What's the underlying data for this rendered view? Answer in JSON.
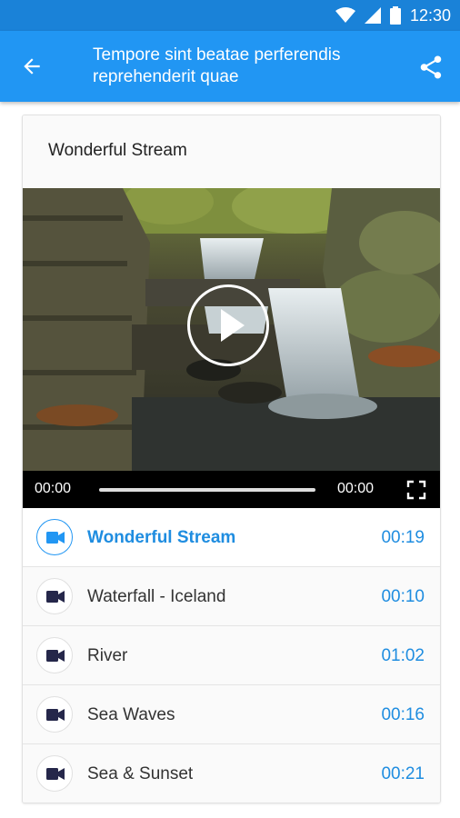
{
  "status_bar": {
    "time": "12:30"
  },
  "app_bar": {
    "title": "Tempore sint beatae perferendis reprehenderit quae",
    "back_icon": "arrow-left-icon",
    "share_icon": "share-icon"
  },
  "player": {
    "title": "Wonderful Stream",
    "current_time": "00:00",
    "duration": "00:00",
    "progress": 0
  },
  "playlist": [
    {
      "label": "Wonderful Stream",
      "duration": "00:19",
      "active": true
    },
    {
      "label": "Waterfall - Iceland",
      "duration": "00:10",
      "active": false
    },
    {
      "label": "River",
      "duration": "01:02",
      "active": false
    },
    {
      "label": "Sea Waves",
      "duration": "00:16",
      "active": false
    },
    {
      "label": "Sea & Sunset",
      "duration": "00:21",
      "active": false
    }
  ],
  "colors": {
    "primary": "#2196f3",
    "status_bar": "#1a82d8",
    "accent_text": "#1f8de0"
  }
}
